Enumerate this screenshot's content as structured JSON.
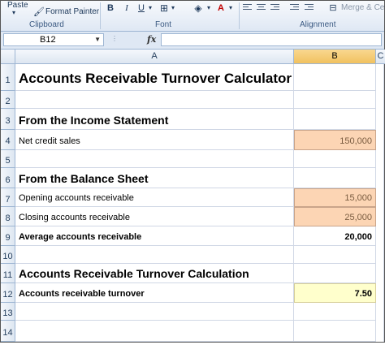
{
  "ribbon": {
    "paste_label": "Paste",
    "format_painter_label": "Format Painter",
    "clipboard_label": "Clipboard",
    "font_label": "Font",
    "alignment_label": "Alignment",
    "merge_label": "Merge & Ce",
    "bold_label": "B",
    "italic_label": "I",
    "underline_label": "U"
  },
  "formula_bar": {
    "name_box": "B12",
    "fx_label": "fx",
    "formula": ""
  },
  "columns": {
    "a": "A",
    "b": "B",
    "c": "C"
  },
  "rows": [
    "1",
    "2",
    "3",
    "4",
    "5",
    "6",
    "7",
    "8",
    "9",
    "10",
    "11",
    "12",
    "13",
    "14"
  ],
  "sheet": {
    "title": "Accounts Receivable Turnover Calculator",
    "income_heading": "From the Income Statement",
    "net_credit_sales_label": "Net credit sales",
    "net_credit_sales_value": "150,000",
    "balance_heading": "From the Balance Sheet",
    "opening_label": "Opening accounts receivable",
    "opening_value": "15,000",
    "closing_label": "Closing accounts receivable",
    "closing_value": "25,000",
    "average_label": "Average accounts receivable",
    "average_value": "20,000",
    "calc_heading": "Accounts Receivable Turnover Calculation",
    "turnover_label": "Accounts receivable turnover",
    "turnover_value": "7.50"
  },
  "colors": {
    "input_fill": "#fcd5b4",
    "result_fill": "#ffffcc"
  }
}
